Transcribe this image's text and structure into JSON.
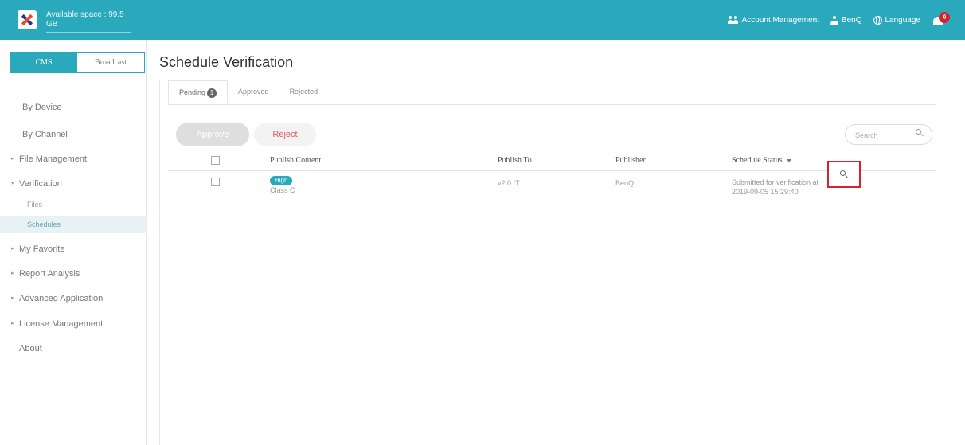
{
  "header": {
    "available_space": "Available space : 99.5 GB",
    "account_management": "Account Management",
    "user": "BenQ",
    "language": "Language",
    "notification_count": "0"
  },
  "sidebar": {
    "modes": [
      "CMS",
      "Broadcast"
    ],
    "items": [
      {
        "label": "By Device",
        "caret": false
      },
      {
        "label": "By Channel",
        "caret": false
      },
      {
        "label": "File Management",
        "caret": true
      },
      {
        "label": "Verification",
        "caret": true,
        "expanded": true
      },
      {
        "label": "My Favorite",
        "caret": true
      },
      {
        "label": "Report Analysis",
        "caret": true
      },
      {
        "label": "Advanced Application",
        "caret": true
      },
      {
        "label": "License Management",
        "caret": true
      },
      {
        "label": "About",
        "caret": false
      }
    ],
    "sub_items": [
      "Files",
      "Schedules"
    ]
  },
  "page": {
    "title": "Schedule Verification",
    "tabs": [
      {
        "label": "Pending",
        "count": "1"
      },
      {
        "label": "Approved"
      },
      {
        "label": "Rejected"
      }
    ],
    "approve_label": "Approve",
    "reject_label": "Reject",
    "search_placeholder": "Search"
  },
  "table": {
    "columns": [
      "Publish Content",
      "Publish To",
      "Publisher",
      "Schedule Status"
    ],
    "rows": [
      {
        "priority": "High",
        "content": "Class C",
        "publish_to": "v2.0 IT",
        "publisher": "BenQ",
        "status_line1": "Submitted for verification at",
        "status_line2": "2019-09-05 15:29:40"
      }
    ]
  },
  "colors": {
    "brand": "#2aa9bd",
    "alert": "#d9202e",
    "reject_text": "#e85a6a"
  }
}
